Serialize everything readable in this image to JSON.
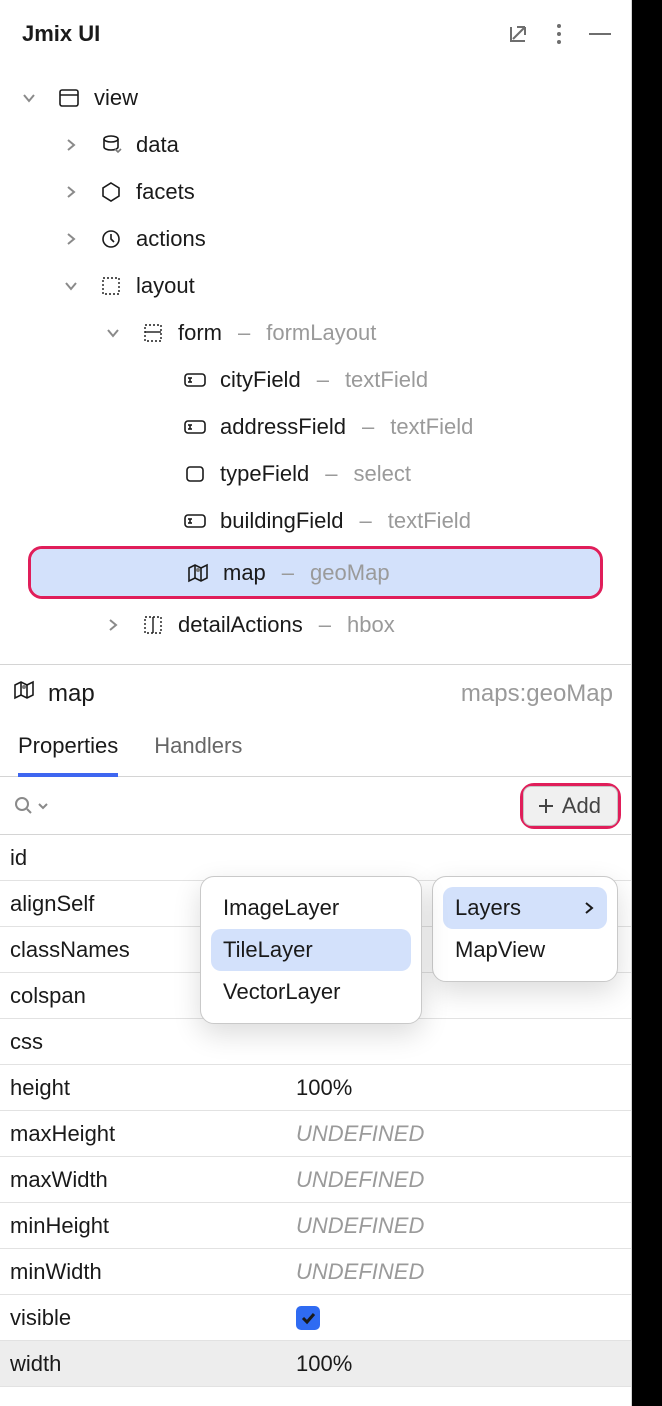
{
  "header": {
    "title": "Jmix UI"
  },
  "tree": {
    "view": {
      "label": "view"
    },
    "data": {
      "label": "data"
    },
    "facets": {
      "label": "facets"
    },
    "actions": {
      "label": "actions"
    },
    "layout": {
      "label": "layout"
    },
    "form": {
      "label": "form",
      "sub": "formLayout"
    },
    "cityField": {
      "label": "cityField",
      "sub": "textField"
    },
    "addressField": {
      "label": "addressField",
      "sub": "textField"
    },
    "typeField": {
      "label": "typeField",
      "sub": "select"
    },
    "buildingField": {
      "label": "buildingField",
      "sub": "textField"
    },
    "map": {
      "label": "map",
      "sub": "geoMap"
    },
    "detailActions": {
      "label": "detailActions",
      "sub": "hbox"
    }
  },
  "inspector": {
    "name": "map",
    "type": "maps:geoMap",
    "tabs": {
      "properties": "Properties",
      "handlers": "Handlers"
    }
  },
  "toolbar": {
    "add": "Add"
  },
  "props": {
    "id": {
      "key": "id",
      "val": ""
    },
    "alignSelf": {
      "key": "alignSelf",
      "val": ""
    },
    "classNames": {
      "key": "classNames",
      "val": ""
    },
    "colspan": {
      "key": "colspan",
      "val": ""
    },
    "css": {
      "key": "css",
      "val": ""
    },
    "height": {
      "key": "height",
      "val": "100%"
    },
    "maxHeight": {
      "key": "maxHeight",
      "val": "UNDEFINED"
    },
    "maxWidth": {
      "key": "maxWidth",
      "val": "UNDEFINED"
    },
    "minHeight": {
      "key": "minHeight",
      "val": "UNDEFINED"
    },
    "minWidth": {
      "key": "minWidth",
      "val": "UNDEFINED"
    },
    "visible": {
      "key": "visible"
    },
    "width": {
      "key": "width",
      "val": "100%"
    }
  },
  "popup1": {
    "layers": "Layers",
    "mapView": "MapView"
  },
  "popup2": {
    "imageLayer": "ImageLayer",
    "tileLayer": "TileLayer",
    "vectorLayer": "VectorLayer"
  }
}
